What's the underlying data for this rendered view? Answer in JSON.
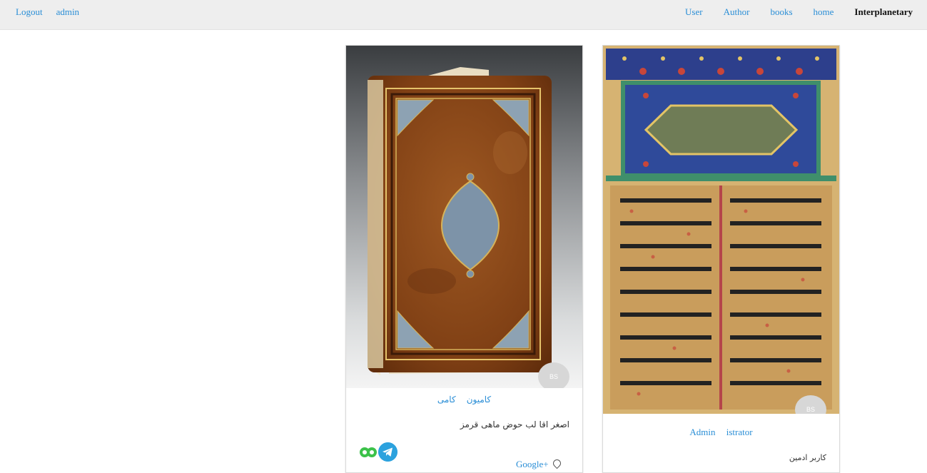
{
  "nav": {
    "left": [
      {
        "label": "Logout"
      },
      {
        "label": "admin"
      }
    ],
    "right": [
      {
        "label": "User"
      },
      {
        "label": "Author"
      },
      {
        "label": "books"
      },
      {
        "label": "home"
      }
    ],
    "brand": "Interplanetary"
  },
  "cards": [
    {
      "image": "book-cover-image",
      "avatar_text": "BS",
      "authors": [
        "کامی",
        "کامیون"
      ],
      "caption": "اصغر اقا لب حوض ماهی قرمز",
      "share": [
        "telegram-icon",
        "share-green-icon"
      ],
      "link": "Google+"
    },
    {
      "image": "illuminated-manuscript-image",
      "avatar_text": "BS",
      "authors": [
        "Admin",
        "istrator"
      ],
      "caption": "کاربر ادمین"
    }
  ],
  "colors": {
    "link": "#2a8ed6",
    "navbar_bg": "#eeeeee",
    "avatar": "#d7d7d7",
    "telegram": "#2ca2de",
    "share_green": "#3cc24a"
  }
}
